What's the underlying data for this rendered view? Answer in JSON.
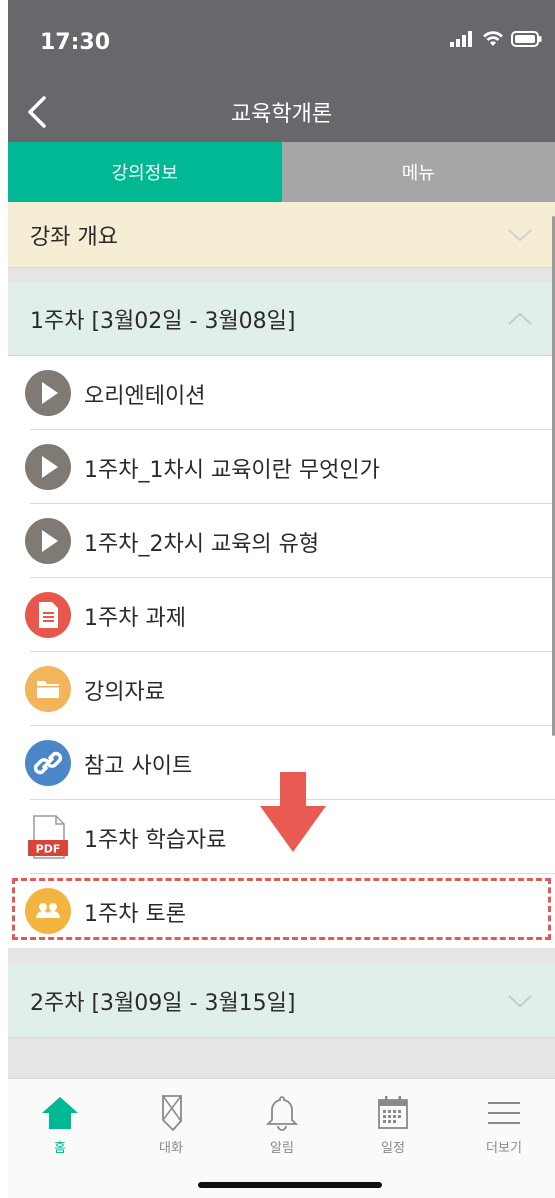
{
  "status_bar": {
    "time": "17:30"
  },
  "header": {
    "title": "교육학개론"
  },
  "tabs": [
    {
      "label": "강의정보",
      "active": true
    },
    {
      "label": "메뉴",
      "active": false
    }
  ],
  "sections": {
    "overview": {
      "title": "강좌 개요",
      "expanded": false
    },
    "week1": {
      "title": "1주차 [3월02일 - 3월08일]",
      "expanded": true
    },
    "week2": {
      "title": "2주차 [3월09일 - 3월15일]",
      "expanded": false
    }
  },
  "week1_items": [
    {
      "label": "오리엔테이션",
      "icon": "video-play-icon"
    },
    {
      "label": "1주차_1차시 교육이란 무엇인가",
      "icon": "video-play-icon"
    },
    {
      "label": "1주차_2차시 교육의 유형",
      "icon": "video-play-icon"
    },
    {
      "label": "1주차 과제",
      "icon": "assignment-icon"
    },
    {
      "label": "강의자료",
      "icon": "folder-icon"
    },
    {
      "label": "참고 사이트",
      "icon": "link-icon"
    },
    {
      "label": "1주차 학습자료",
      "icon": "pdf-icon"
    },
    {
      "label": "1주차 토론",
      "icon": "forum-icon"
    }
  ],
  "bottom_nav": [
    {
      "label": "홈",
      "icon": "home-icon",
      "active": true
    },
    {
      "label": "대화",
      "icon": "chat-icon",
      "active": false
    },
    {
      "label": "알림",
      "icon": "bell-icon",
      "active": false
    },
    {
      "label": "일정",
      "icon": "calendar-icon",
      "active": false
    },
    {
      "label": "더보기",
      "icon": "menu-icon",
      "active": false
    }
  ],
  "pdf_badge": "PDF",
  "colors": {
    "header_bg": "#68686c",
    "tab_active": "#00b894",
    "tab_inactive": "#a6a6a6",
    "overview_bg": "#f5eed5",
    "week_bg": "#e0efe9",
    "highlight": "#e05a5a",
    "nav_active": "#00b894"
  }
}
